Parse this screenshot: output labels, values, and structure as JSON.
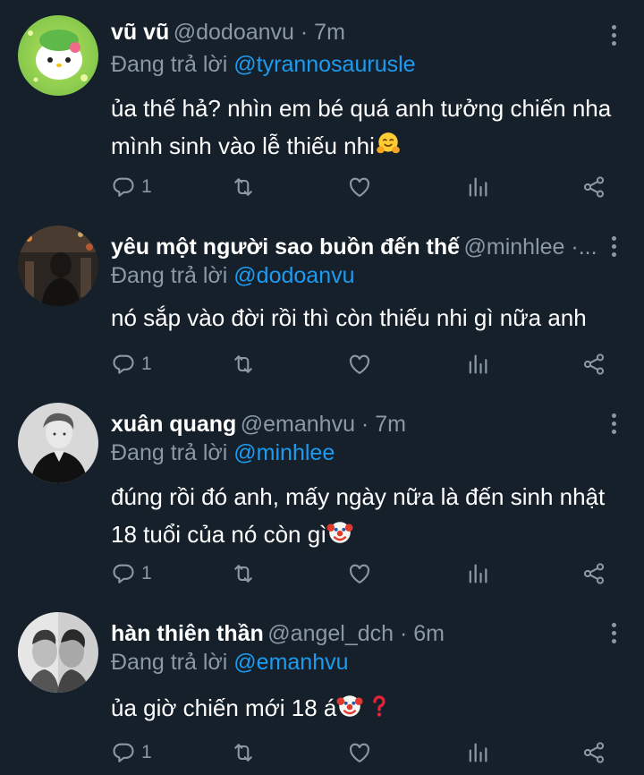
{
  "reply_prefix": "Đang trả lời",
  "tweets": [
    {
      "name": "vũ vũ",
      "handle": "@dodoanvu · 7m",
      "reply_to": "@tyrannosaurusle",
      "lines": [
        "ủa thế hả? nhìn em bé quá anh tưởng chiến nha",
        "mình sinh vào lễ thiếu nhi"
      ],
      "line_emoji": [
        "",
        "hugging-face"
      ],
      "reply_count": "1"
    },
    {
      "name": "yêu một người sao buồn đến thế",
      "handle": "@minhlee ·...",
      "reply_to": "@dodoanvu",
      "lines": [
        "nó sắp vào đời rồi thì còn thiếu nhi gì nữa anh"
      ],
      "reply_count": "1"
    },
    {
      "name": "xuân quang",
      "handle": "@emanhvu · 7m",
      "reply_to": "@minhlee",
      "lines": [
        "đúng rồi đó anh, mấy ngày nữa là đến sinh nhật",
        "18 tuổi của nó còn gì"
      ],
      "line_emoji": [
        "",
        "clown-face"
      ],
      "reply_count": "1"
    },
    {
      "name": "hàn thiên thần",
      "handle": "@angel_dch · 6m",
      "reply_to": "@emanhvu",
      "lines": [
        "ủa giờ chiến mới 18 á"
      ],
      "line_emoji": [
        "clown-face red-question-mark"
      ],
      "reply_count": "1"
    }
  ],
  "colors": {
    "background": "#15202b",
    "text": "#ffffff",
    "secondary": "#8b98a5",
    "link": "#1d9bf0"
  }
}
